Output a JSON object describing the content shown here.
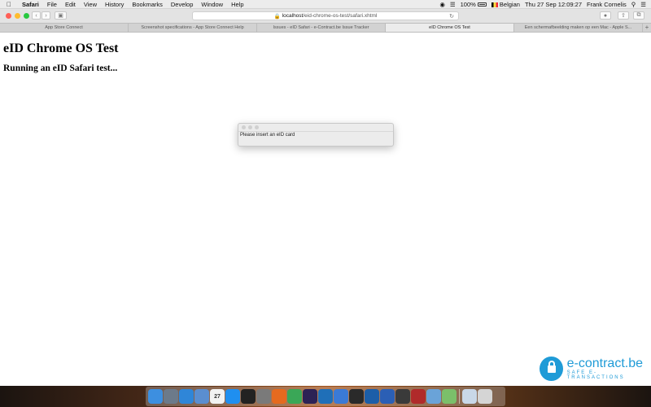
{
  "menubar": {
    "apple": "",
    "app": "Safari",
    "items": [
      "File",
      "Edit",
      "View",
      "History",
      "Bookmarks",
      "Develop",
      "Window",
      "Help"
    ],
    "battery": "100%",
    "input_source": "Belgian",
    "clock": "Thu 27 Sep  12:09:27",
    "user": "Frank Cornelis"
  },
  "browser": {
    "url_host": "localhost",
    "url_path": "/eid-chrome-os-test/safari.xhtml",
    "tabs": [
      {
        "label": "App Store Connect",
        "active": false
      },
      {
        "label": "Screenshot specifications - App Store Connect Help",
        "active": false
      },
      {
        "label": "Issues - eID Safari - e-Contract.be Issue Tracker",
        "active": false
      },
      {
        "label": "eID Chrome OS Test",
        "active": true
      },
      {
        "label": "Een schermafbeelding maken op een Mac - Apple S...",
        "active": false
      }
    ],
    "add_tab": "+"
  },
  "page": {
    "heading": "eID Chrome OS Test",
    "subheading": "Running an eID Safari test..."
  },
  "dialog": {
    "message": "Please insert an eID card"
  },
  "logo": {
    "brand": "e-contract.be",
    "tagline": "SAFE E-TRANSACTIONS",
    "color": "#1f9bd7"
  },
  "dock": {
    "apps": [
      {
        "name": "finder-icon",
        "color": "#3d8fe0"
      },
      {
        "name": "launchpad-icon",
        "color": "#6c7a8a"
      },
      {
        "name": "safari-icon",
        "color": "#2f86d8"
      },
      {
        "name": "preview-icon",
        "color": "#5a8ed0"
      },
      {
        "name": "calendar-icon",
        "color": "#f2f2f2",
        "text": "27"
      },
      {
        "name": "app-store-icon",
        "color": "#1f8ff0"
      },
      {
        "name": "terminal-icon",
        "color": "#222222"
      },
      {
        "name": "system-preferences-icon",
        "color": "#7a7a7a"
      },
      {
        "name": "firefox-icon",
        "color": "#e56a1f"
      },
      {
        "name": "chrome-icon",
        "color": "#3aa757"
      },
      {
        "name": "eclipse-icon",
        "color": "#2c2255"
      },
      {
        "name": "vscode-icon",
        "color": "#1f6fb8"
      },
      {
        "name": "xcode-icon",
        "color": "#3b7ad6"
      },
      {
        "name": "console-icon",
        "color": "#2a2a2a"
      },
      {
        "name": "virtualbox-icon",
        "color": "#1c5ea8"
      },
      {
        "name": "word-icon",
        "color": "#2b5fb5"
      },
      {
        "name": "activity-monitor-icon",
        "color": "#3a3a3a"
      },
      {
        "name": "photo-booth-icon",
        "color": "#b02a2a"
      },
      {
        "name": "parcel-icon",
        "color": "#6aa3d8"
      },
      {
        "name": "maps-icon",
        "color": "#7bbf6a"
      },
      {
        "name": "downloads-icon",
        "color": "#c9d8e8"
      },
      {
        "name": "trash-icon",
        "color": "#d5d5d5"
      }
    ]
  }
}
